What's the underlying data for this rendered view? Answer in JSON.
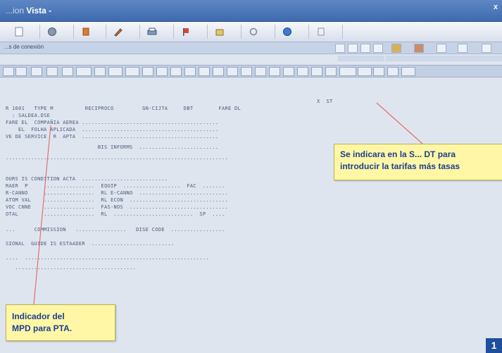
{
  "window": {
    "title_prefix": "...ion",
    "title": "Vista -",
    "close_glyph": "x"
  },
  "toolbar": {
    "icons": [
      "document-icon",
      "globe-icon",
      "calendar-icon",
      "edit-icon",
      "printer-icon",
      "flag-icon",
      "folder-icon",
      "refresh-icon",
      "sphere-icon",
      "help-icon"
    ]
  },
  "bar2": {
    "label": "...s de conexión"
  },
  "terminal": {
    "lines": [
      "R 1601   TYPE M          RECIPROCO         GN-CIJTA     DBT        FARE DL",
      "  : SALDEA.DSE",
      "FARE EL  COMPAÑIA AEREA ...........................................",
      "    EL  FOLHA APLICADA  ...........................................",
      "VE DE SERVICE  R  APTA  ...........................................",
      "                             BIS INFORMS  .........................",
      "......................................................................",
      "OURS IS CONDITION ACTA  ...........................",
      "RAER  P     ................  EQUIP  ..................  FAC  .......",
      "R-CANNO     ................  RL E-CANNO  ............................",
      "ATOM VAL    ................  RL ECON  ...............................",
      "VOC CNNE    ................  FAS-NOS  ...............................",
      "OTAL        ................  RL  .........................  SP  ....",
      "...      COMMISSION   ................   DISE CODE  .................",
      "SIONAL  GUIDE IS ESTAADER  ..........................",
      "....  ..........................................................",
      "   ......................................"
    ],
    "top_right_tag": "X  ST"
  },
  "callouts": {
    "right": [
      "Se indicara en la S... DT para",
      "introducir la tarifas más tasas"
    ],
    "left": [
      "Indicador del",
      "MPD para PTA."
    ]
  },
  "page_badge": "1"
}
